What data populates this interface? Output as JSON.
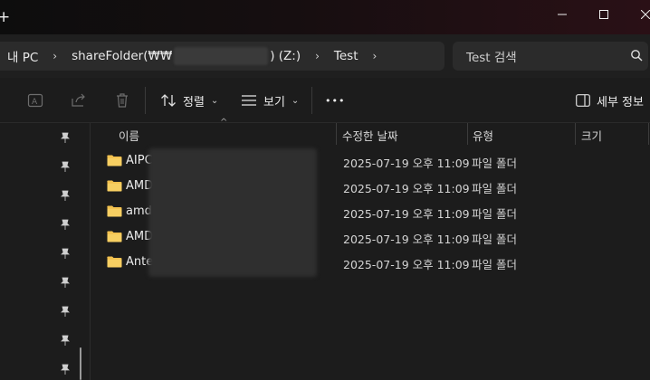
{
  "window": {
    "new_tab_glyph": "+",
    "minimize_icon": "minimize-icon",
    "maximize_icon": "maximize-icon",
    "close_icon": "close-icon"
  },
  "address": {
    "crumbs": [
      "내 PC",
      "shareFolder(₩₩",
      ") (Z:)",
      "Test"
    ],
    "chevron": "›"
  },
  "search": {
    "placeholder": "Test 검색"
  },
  "toolbar": {
    "sort_label": "정렬",
    "view_label": "보기",
    "more_label": "•••",
    "details_label": "세부 정보",
    "dropdown_glyph": "⌄"
  },
  "columns": {
    "name": "이름",
    "modified": "수정한 날짜",
    "type": "유형",
    "size": "크기",
    "sort_indicator": "^"
  },
  "files": [
    {
      "name": "AIPC",
      "modified": "2025-07-19 오후 11:09",
      "type": "파일 폴더"
    },
    {
      "name": "AMD",
      "modified": "2025-07-19 오후 11:09",
      "type": "파일 폴더"
    },
    {
      "name": "amd",
      "modified": "2025-07-19 오후 11:09",
      "type": "파일 폴더"
    },
    {
      "name": "AMD",
      "modified": "2025-07-19 오후 11:09",
      "type": "파일 폴더"
    },
    {
      "name": "Ante",
      "modified": "2025-07-19 오후 11:09",
      "type": "파일 폴더"
    }
  ],
  "colors": {
    "background": "#1c1c1c",
    "folder": "#f2c14e",
    "accent": "#e6e6e6"
  }
}
